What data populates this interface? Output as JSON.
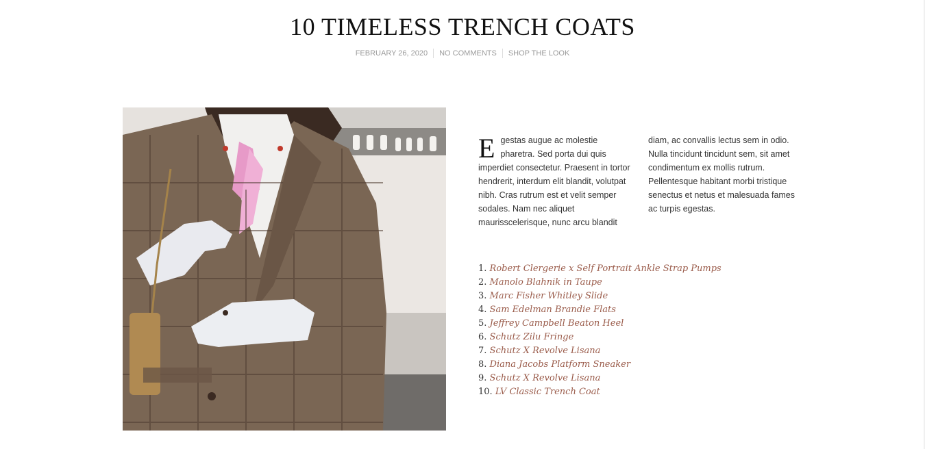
{
  "post": {
    "title": "10 TIMELESS TRENCH COATS",
    "meta": {
      "date": "FEBRUARY 26, 2020",
      "comments": "NO COMMENTS",
      "category": "SHOP THE LOOK"
    },
    "intro": {
      "dropcap": "E",
      "text": "gestas augue ac molestie pharetra. Sed porta dui quis imperdiet consectetur. Praesent in tortor hendrerit, interdum elit blandit, volutpat nibh. Cras rutrum est et velit semper sodales. Nam nec aliquet maurisscelerisque, nunc arcu blandit diam, ac convallis lectus sem in odio. Nulla tincidunt tincidunt sem, sit amet condimentum ex mollis rutrum. Pellentesque habitant morbi tristique senectus et netus et malesuada fames ac turpis egestas."
    },
    "shop_list": [
      {
        "num": "1.",
        "label": "Robert Clergerie x Self Portrait Ankle Strap Pumps"
      },
      {
        "num": "2.",
        "label": "Manolo Blahnik in Taupe"
      },
      {
        "num": "3.",
        "label": "Marc Fisher Whitley Slide"
      },
      {
        "num": "4.",
        "label": "Sam Edelman Brandie Flats"
      },
      {
        "num": "5.",
        "label": "Jeffrey Campbell Beaton Heel"
      },
      {
        "num": "6.",
        "label": "Schutz Zilu Fringe"
      },
      {
        "num": "7.",
        "label": "Schutz X Revolve Lisana"
      },
      {
        "num": "8.",
        "label": "Diana Jacobs Platform Sneaker"
      },
      {
        "num": "9.",
        "label": "Schutz X Revolve Lisana"
      },
      {
        "num": "10.",
        "label": "LV Classic Trench Coat"
      }
    ]
  },
  "colors": {
    "link": "#9a5b4a",
    "meta": "#9a9a9a",
    "jacket": "#7a6654"
  }
}
